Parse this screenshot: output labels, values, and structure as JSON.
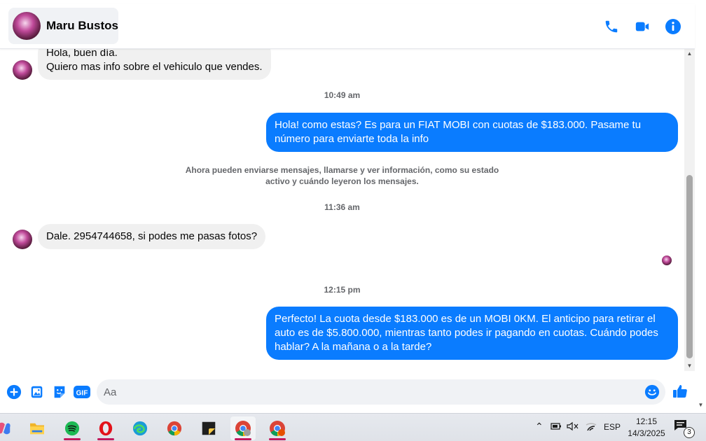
{
  "header": {
    "contact_name": "Maru Bustos",
    "icons": [
      "phone-icon",
      "video-camera-icon",
      "info-icon"
    ],
    "accent_color": "#0a7cff"
  },
  "messages": [
    {
      "type": "incoming",
      "text": "Hola, buen día.\nQuiero mas info sobre el vehiculo que vendes."
    },
    {
      "type": "timestamp",
      "text": "10:49 am"
    },
    {
      "type": "outgoing",
      "text": "Hola! como estas? Es para un FIAT MOBI con cuotas de $183.000. Pasame tu número para enviarte toda la info"
    },
    {
      "type": "system",
      "line1": "Ahora pueden enviarse mensajes, llamarse y ver información, como su estado",
      "line2": "activo y cuándo leyeron los mensajes."
    },
    {
      "type": "timestamp",
      "text": "11:36 am"
    },
    {
      "type": "incoming",
      "text": "Dale. 2954744658, si podes me pasas fotos?"
    },
    {
      "type": "timestamp",
      "text": "12:15 pm"
    },
    {
      "type": "outgoing",
      "text": "Perfecto! La cuota desde $183.000 es de un MOBI 0KM. El anticipo para retirar el auto es de $5.800.000, mientras tanto podes ir pagando en cuotas. Cuándo podes hablar? A la mañana o a la tarde?"
    }
  ],
  "composer": {
    "placeholder": "Aa",
    "gif_label": "GIF",
    "icons": [
      "plus-icon",
      "gallery-icon",
      "sticker-icon",
      "gif-icon",
      "emoji-icon",
      "like-icon"
    ]
  },
  "taskbar": {
    "apps": [
      "copilot-icon",
      "file-explorer-icon",
      "spotify-icon",
      "opera-icon",
      "edge-icon",
      "chrome-icon",
      "sticky-notes-icon",
      "chrome-profile-icon",
      "chrome-profile-2-icon"
    ],
    "language": "ESP",
    "time": "12:15",
    "date": "14/3/2025",
    "notification_count": "3"
  }
}
